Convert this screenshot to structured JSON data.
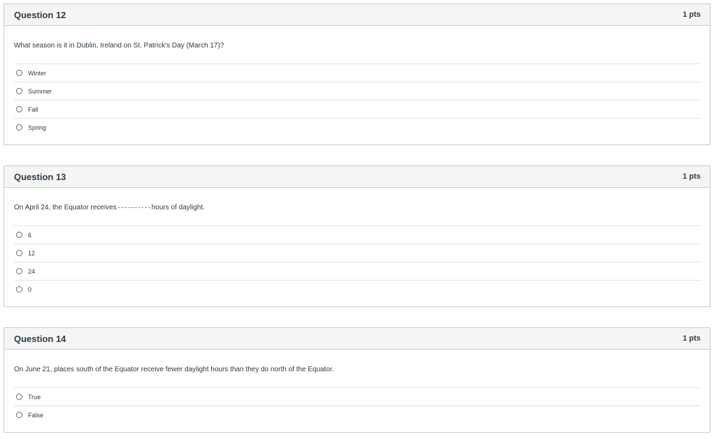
{
  "questions": [
    {
      "title": "Question 12",
      "points": "1 pts",
      "text": "What season is it in Dublin, Ireland on St. Patrick's Day (March 17)?",
      "answers": [
        "Winter",
        "Summer",
        "Fall",
        "Spring"
      ]
    },
    {
      "title": "Question 13",
      "points": "1 pts",
      "text_before": "On April 24, the Equator receives",
      "text_after": "hours of daylight.",
      "answers": [
        "6",
        "12",
        "24",
        "0"
      ]
    },
    {
      "title": "Question 14",
      "points": "1 pts",
      "text": "On June 21, places south of the Equator receive fewer daylight hours than they do north of the Equator.",
      "answers": [
        "True",
        "False"
      ]
    }
  ]
}
